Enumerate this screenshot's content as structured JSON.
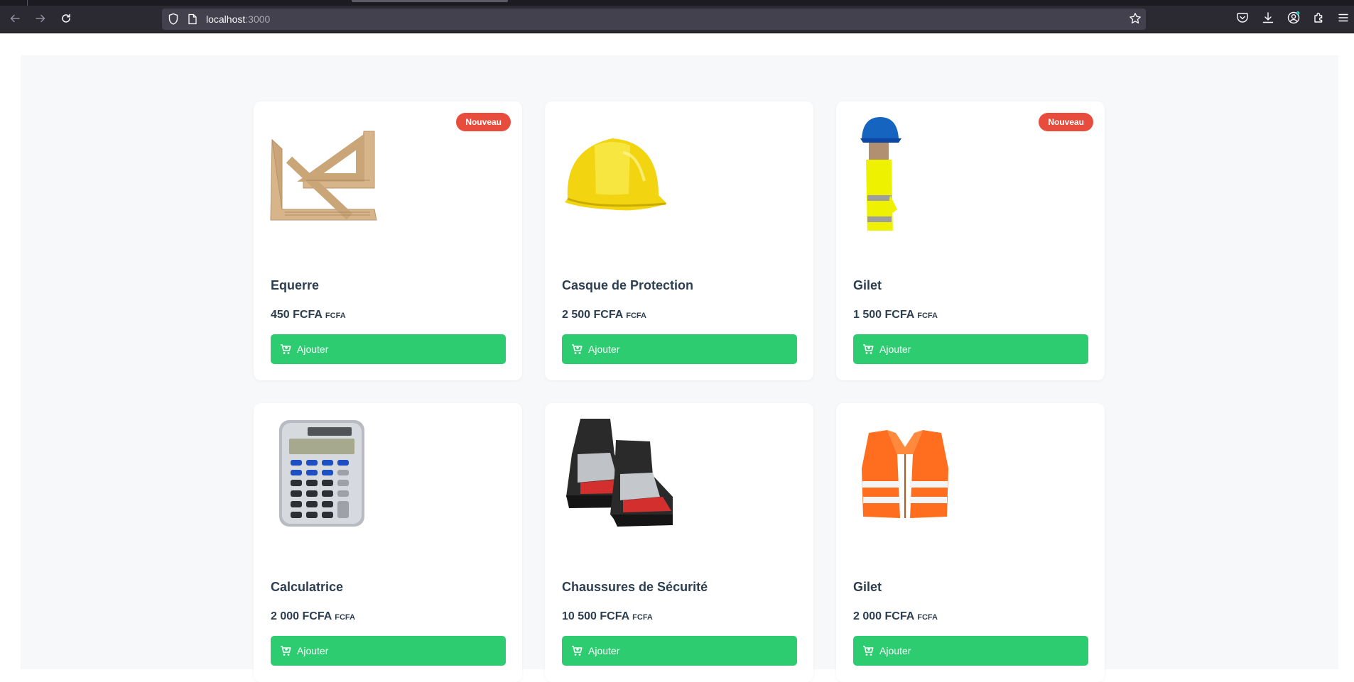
{
  "browser": {
    "url_host": "localhost",
    "url_port": ":3000"
  },
  "colors": {
    "badge": "#e74c3c",
    "button": "#2ecc71",
    "text": "#2c3e50"
  },
  "products": [
    {
      "name": "Equerre",
      "price": "450 FCFA",
      "currency": "FCFA",
      "badge": "Nouveau",
      "button": "Ajouter",
      "image": "set-square-image"
    },
    {
      "name": "Casque de Protection",
      "price": "2 500 FCFA",
      "currency": "FCFA",
      "badge": "",
      "button": "Ajouter",
      "image": "hard-hat-image"
    },
    {
      "name": "Gilet",
      "price": "1 500 FCFA",
      "currency": "FCFA",
      "badge": "Nouveau",
      "button": "Ajouter",
      "image": "safety-outfit-image"
    },
    {
      "name": "Calculatrice",
      "price": "2 000 FCFA",
      "currency": "FCFA",
      "badge": "",
      "button": "Ajouter",
      "image": "calculator-image"
    },
    {
      "name": "Chaussures de Sécurité",
      "price": "10 500 FCFA",
      "currency": "FCFA",
      "badge": "",
      "button": "Ajouter",
      "image": "safety-boots-image"
    },
    {
      "name": "Gilet",
      "price": "2 000 FCFA",
      "currency": "FCFA",
      "badge": "",
      "button": "Ajouter",
      "image": "safety-vest-image"
    }
  ]
}
